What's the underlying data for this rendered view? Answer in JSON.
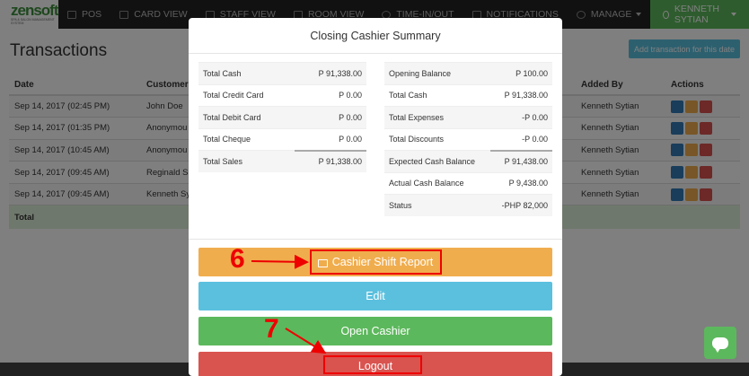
{
  "nav": {
    "brand": "zensoft",
    "brand_tagline": "SPA & SALON MANAGEMENT SYSTEM",
    "items": [
      {
        "label": "POS",
        "icon": "monitor-icon"
      },
      {
        "label": "CARD VIEW",
        "icon": "card-icon"
      },
      {
        "label": "STAFF VIEW",
        "icon": "calendar-icon"
      },
      {
        "label": "ROOM VIEW",
        "icon": "calendar-icon"
      },
      {
        "label": "TIME-IN/OUT",
        "icon": "clock-icon"
      },
      {
        "label": "NOTIFICATIONS",
        "icon": "bell-icon"
      },
      {
        "label": "MANAGE",
        "icon": "gear-icon"
      }
    ],
    "user": "KENNETH SYTIAN"
  },
  "page": {
    "title": "Transactions",
    "add_button": "Add transaction for this date"
  },
  "table": {
    "headers": [
      "Date",
      "Customer",
      "Added By",
      "Actions"
    ],
    "rows": [
      {
        "date": "Sep 14, 2017 (02:45 PM)",
        "customer": "John Doe",
        "added_by": "Kenneth Sytian"
      },
      {
        "date": "Sep 14, 2017 (01:35 PM)",
        "customer": "Anonymou",
        "added_by": "Kenneth Sytian"
      },
      {
        "date": "Sep 14, 2017 (10:45 AM)",
        "customer": "Anonymou",
        "added_by": "Kenneth Sytian"
      },
      {
        "date": "Sep 14, 2017 (09:45 AM)",
        "customer": "Reginald Sa",
        "added_by": "Kenneth Sytian"
      },
      {
        "date": "Sep 14, 2017 (09:45 AM)",
        "customer": "Kenneth Syt",
        "added_by": "Kenneth Sytian"
      }
    ],
    "total_label": "Total"
  },
  "modal": {
    "title": "Closing Cashier Summary",
    "left": [
      {
        "label": "Total Cash",
        "value": "P 91,338.00"
      },
      {
        "label": "Total Credit Card",
        "value": "P 0.00"
      },
      {
        "label": "Total Debit Card",
        "value": "P 0.00"
      },
      {
        "label": "Total Cheque",
        "value": "P 0.00"
      },
      {
        "label": "Total Sales",
        "value": "P 91,338.00"
      }
    ],
    "right": [
      {
        "label": "Opening Balance",
        "value": "P 100.00"
      },
      {
        "label": "Total Cash",
        "value": "P 91,338.00"
      },
      {
        "label": "Total Expenses",
        "value": "-P 0.00"
      },
      {
        "label": "Total Discounts",
        "value": "-P 0.00"
      },
      {
        "label": "Expected Cash Balance",
        "value": "P 91,438.00"
      },
      {
        "label": "Actual Cash Balance",
        "value": "P 9,438.00"
      },
      {
        "label": "Status",
        "value": "-PHP 82,000"
      }
    ],
    "buttons": {
      "report": "Cashier Shift Report",
      "edit": "Edit",
      "open": "Open Cashier",
      "logout": "Logout"
    }
  },
  "annotations": {
    "step6": "6",
    "step7": "7"
  },
  "colors": {
    "annotation": "#ee0000",
    "brand_green": "#5cb85c",
    "orange": "#f0ad4e",
    "cyan": "#5bc0de",
    "red": "#d9534f"
  }
}
